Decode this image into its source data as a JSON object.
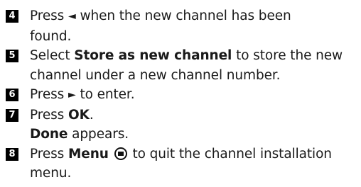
{
  "steps": [
    {
      "number": "4",
      "press": "Press",
      "arrow": "◄",
      "text_1": "when the new channel has been",
      "text_2": "found."
    },
    {
      "number": "5",
      "select": "Select",
      "option": "Store as new channel",
      "text_1": "to store the new",
      "text_2": "channel under a new channel number."
    },
    {
      "number": "6",
      "press": "Press",
      "arrow": "►",
      "text_1": "to enter."
    },
    {
      "number": "7",
      "press": "Press",
      "key": "OK",
      "end": ".",
      "result_word": "Done",
      "result_text": "appears."
    },
    {
      "number": "8",
      "press": "Press",
      "key": "Menu",
      "icon": "menu-button-icon",
      "text_1": "to quit the channel installation",
      "text_2": "menu."
    }
  ]
}
